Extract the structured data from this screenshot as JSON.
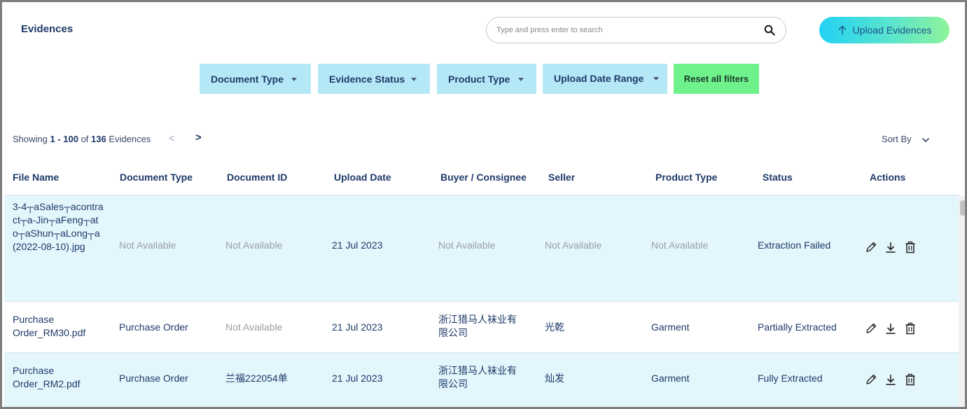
{
  "header": {
    "title": "Evidences",
    "search_placeholder": "Type and press enter to search",
    "upload_label": "Upload Evidences"
  },
  "filters": {
    "document_type": "Document Type",
    "evidence_status": "Evidence Status",
    "product_type": "Product Type",
    "upload_date_range": "Upload Date Range",
    "reset": "Reset all filters"
  },
  "pagination": {
    "prefix": "Showing ",
    "range": "1 - 100",
    "of": " of ",
    "total": "136",
    "suffix": " Evidences",
    "prev": "<",
    "next": ">"
  },
  "sort": {
    "label": "Sort By"
  },
  "table": {
    "columns": [
      "File Name",
      "Document Type",
      "Document ID",
      "Upload Date",
      "Buyer / Consignee",
      "Seller",
      "Product Type",
      "Status",
      "Actions"
    ],
    "rows": [
      {
        "file_name": "3-4┬aSales┬acontract┬a-Jin┬aFeng┬ato┬aShun┬aLong┬a(2022-08-10).jpg",
        "document_type": "Not Available",
        "document_id": "Not Available",
        "upload_date": "21 Jul 2023",
        "buyer": "Not Available",
        "seller": "Not Available",
        "product_type": "Not Available",
        "status": "Extraction Failed"
      },
      {
        "file_name": "Purchase Order_RM30.pdf",
        "document_type": "Purchase Order",
        "document_id": "Not Available",
        "upload_date": "21 Jul 2023",
        "buyer": "浙江猎马人袜业有限公司",
        "seller": "光乾",
        "product_type": "Garment",
        "status": "Partially Extracted"
      },
      {
        "file_name": "Purchase Order_RM2.pdf",
        "document_type": "Purchase Order",
        "document_id": "兰福222054单",
        "upload_date": "21 Jul 2023",
        "buyer": "浙江猎马人袜业有限公司",
        "seller": "灿发",
        "product_type": "Garment",
        "status": "Fully Extracted"
      }
    ]
  },
  "colors": {
    "accent_text": "#1f3a68",
    "filter_bg": "#b5e8f7",
    "reset_bg": "#6ff28c",
    "row_highlight": "#e3f6fc",
    "na_text": "#9a9ea6"
  },
  "icons": [
    "search-icon",
    "arrow-up-icon",
    "chevron-down-icon",
    "edit-pencil-icon",
    "download-icon",
    "trash-icon"
  ]
}
